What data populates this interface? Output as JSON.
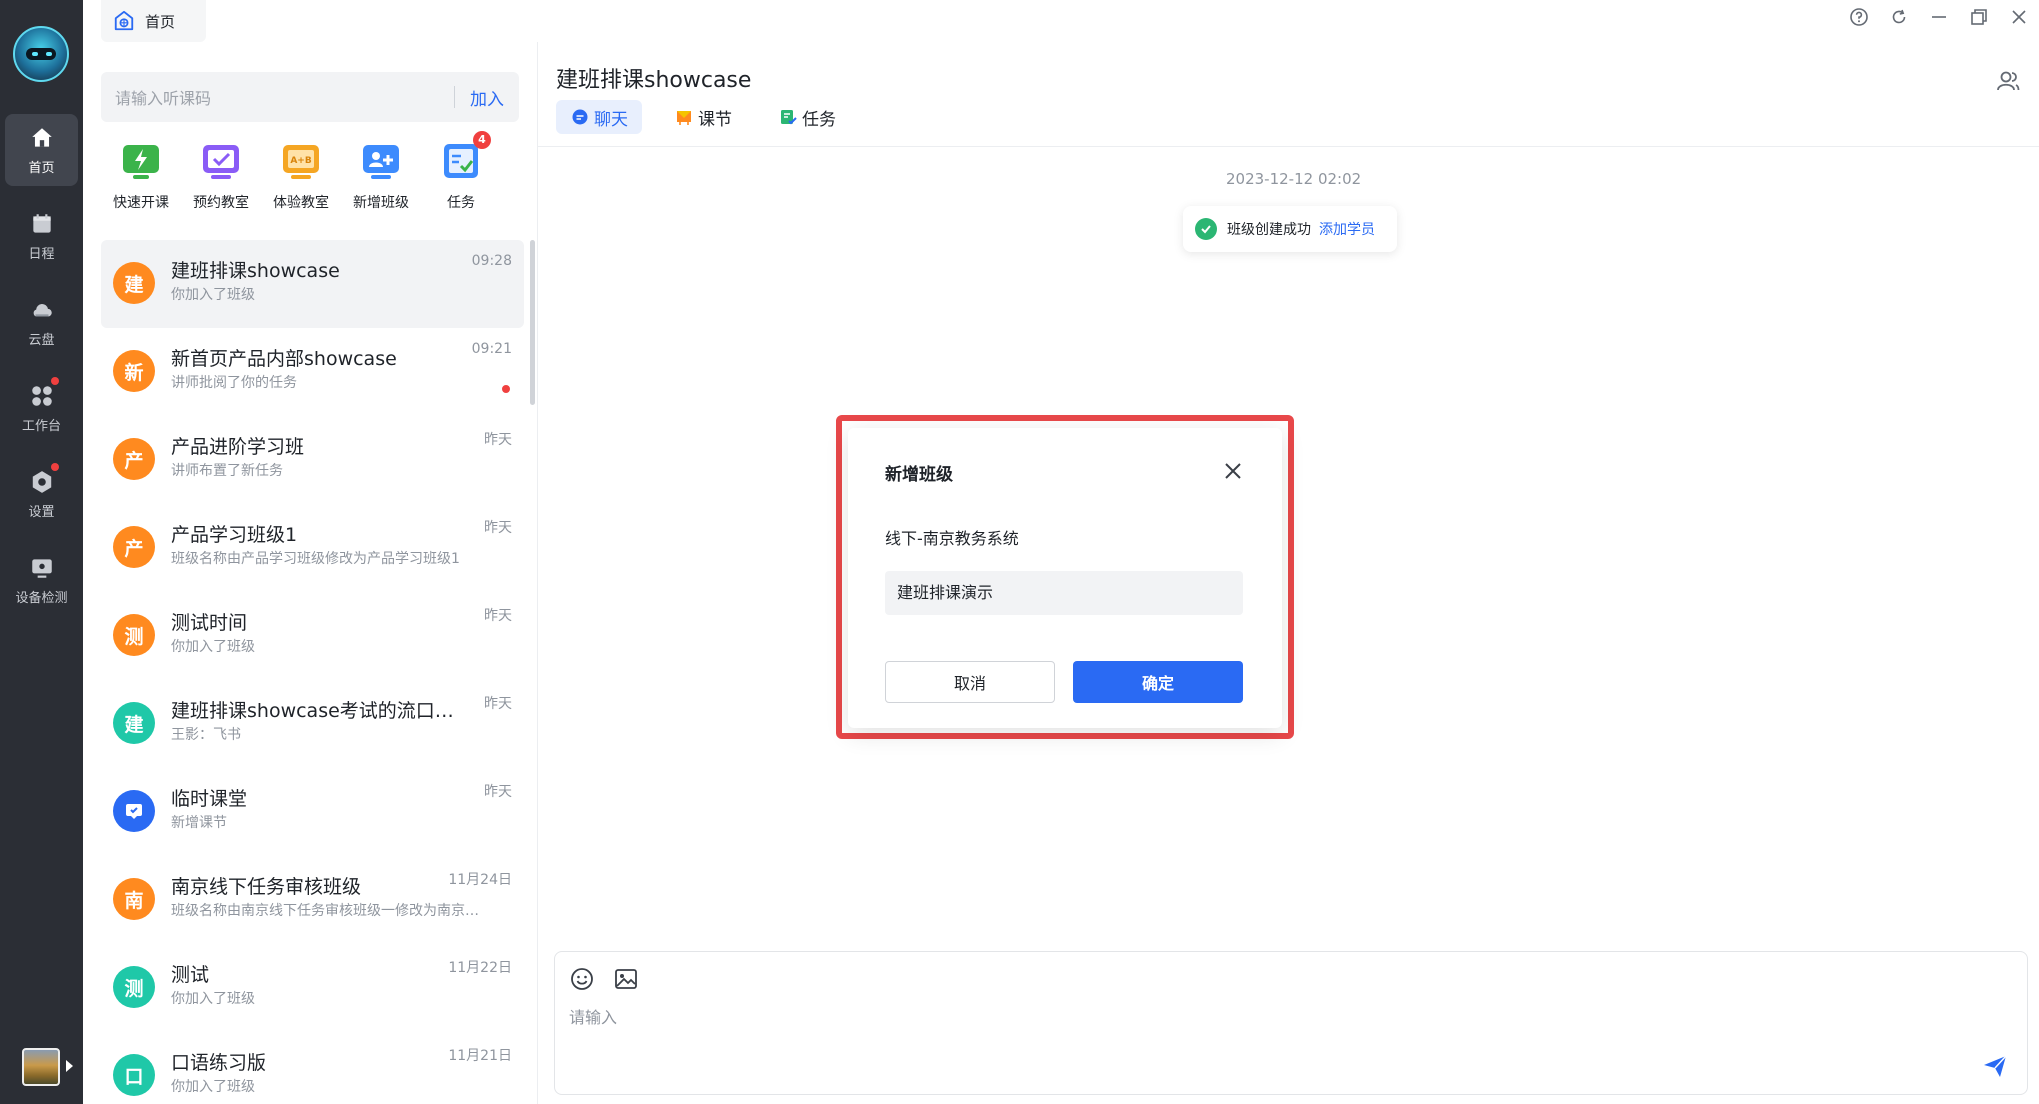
{
  "home_tab": {
    "label": "首页",
    "icon": "home-globe-icon"
  },
  "sidebar": {
    "items": [
      {
        "label": "首页",
        "icon": "home-icon",
        "active": true,
        "dot": false
      },
      {
        "label": "日程",
        "icon": "calendar-icon",
        "active": false,
        "dot": false
      },
      {
        "label": "云盘",
        "icon": "cloud-icon",
        "active": false,
        "dot": false
      },
      {
        "label": "工作台",
        "icon": "apps-icon",
        "active": false,
        "dot": true
      },
      {
        "label": "设置",
        "icon": "settings-icon",
        "active": false,
        "dot": true
      },
      {
        "label": "设备检测",
        "icon": "device-check-icon",
        "active": false,
        "dot": false
      }
    ]
  },
  "search": {
    "placeholder": "请输入听课码",
    "join_label": "加入"
  },
  "quick_actions": [
    {
      "label": "快速开课",
      "icon": "quick-class-icon",
      "color": "#3bb34a"
    },
    {
      "label": "预约教室",
      "icon": "book-classroom-icon",
      "color": "#8a5cf6"
    },
    {
      "label": "体验教室",
      "icon": "trial-classroom-icon",
      "color": "#f5a623"
    },
    {
      "label": "新增班级",
      "icon": "add-class-icon",
      "color": "#3d8bfd"
    },
    {
      "label": "任务",
      "icon": "task-icon",
      "color": "#3d8bfd",
      "badge": "4"
    }
  ],
  "conversations": [
    {
      "avatar": "建",
      "color": "#ff8a1f",
      "title": "建班排课showcase",
      "subtitle": "你加入了班级",
      "time": "09:28",
      "active": true,
      "unread": false
    },
    {
      "avatar": "新",
      "color": "#ff8a1f",
      "title": "新首页产品内部showcase",
      "subtitle": "讲师批阅了你的任务",
      "time": "09:21",
      "active": false,
      "unread": true
    },
    {
      "avatar": "产",
      "color": "#ff8a1f",
      "title": "产品进阶学习班",
      "subtitle": "讲师布置了新任务",
      "time": "昨天",
      "active": false,
      "unread": false
    },
    {
      "avatar": "产",
      "color": "#ff8a1f",
      "title": "产品学习班级1",
      "subtitle": "班级名称由产品学习班级修改为产品学习班级1",
      "time": "昨天",
      "active": false,
      "unread": false
    },
    {
      "avatar": "测",
      "color": "#ff8a1f",
      "title": "测试时间",
      "subtitle": "你加入了班级",
      "time": "昨天",
      "active": false,
      "unread": false
    },
    {
      "avatar": "建",
      "color": "#1fc8a8",
      "title": "建班排课showcase考试的流口水…",
      "subtitle": "王影：飞书",
      "time": "昨天",
      "active": false,
      "unread": false
    },
    {
      "avatar": "",
      "color": "#2a6af3",
      "title": "临时课堂",
      "subtitle": "新增课节",
      "time": "昨天",
      "active": false,
      "unread": false,
      "icon": "temp-classroom-icon"
    },
    {
      "avatar": "南",
      "color": "#ff8a1f",
      "title": "南京线下任务审核班级",
      "subtitle": "班级名称由南京线下任务审核班级一修改为南京…",
      "time": "11月24日",
      "active": false,
      "unread": false
    },
    {
      "avatar": "测",
      "color": "#1fc8a8",
      "title": "测试",
      "subtitle": "你加入了班级",
      "time": "11月22日",
      "active": false,
      "unread": false
    },
    {
      "avatar": "口",
      "color": "#1fc8a8",
      "title": "口语练习版",
      "subtitle": "你加入了班级",
      "time": "11月21日",
      "active": false,
      "unread": false
    }
  ],
  "window_controls": [
    "help-icon",
    "refresh-icon",
    "minimize-icon",
    "restore-icon",
    "close-icon"
  ],
  "chat": {
    "title": "建班排课showcase",
    "tabs": [
      {
        "label": "聊天",
        "icon": "chat-bubble-icon",
        "active": true
      },
      {
        "label": "课节",
        "icon": "lesson-icon",
        "active": false
      },
      {
        "label": "任务",
        "icon": "task-doc-icon",
        "active": false
      }
    ],
    "message_time": "2023-12-12 02:02",
    "system_message": {
      "text": "班级创建成功",
      "link": "添加学员"
    },
    "composer_placeholder": "请输入"
  },
  "modal": {
    "title": "新增班级",
    "org": "线下-南京教务系统",
    "input_value": "建班排课演示",
    "cancel_label": "取消",
    "confirm_label": "确定"
  },
  "colors": {
    "accent": "#2a6af3",
    "highlight": "#e8484a",
    "sidebar_bg": "#2b2e35"
  }
}
